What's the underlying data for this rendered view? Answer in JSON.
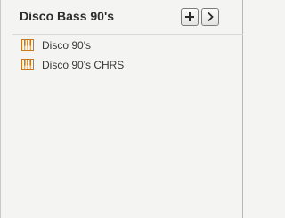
{
  "panel": {
    "title": "Disco Bass 90's",
    "add_button_icon": "plus-icon",
    "next_button_icon": "chevron-right-icon",
    "items": [
      {
        "label": "Disco 90's",
        "icon": "piano-keyboard-icon"
      },
      {
        "label": "Disco 90's CHRS",
        "icon": "piano-keyboard-icon"
      }
    ]
  },
  "colors": {
    "icon_accent": "#c8781e",
    "background": "#f4f4f3",
    "title_text": "#2d2d2d"
  }
}
